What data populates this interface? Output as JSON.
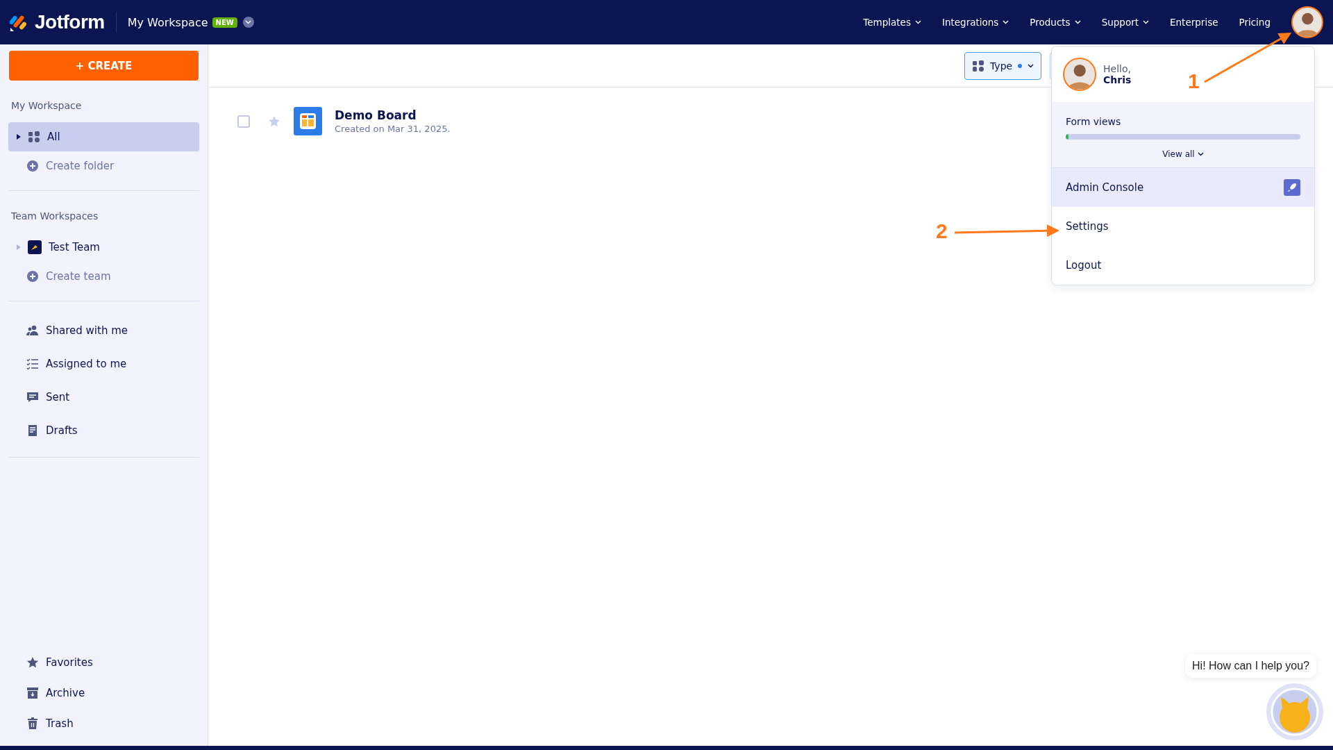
{
  "header": {
    "logo": "Jotform",
    "workspace": "My Workspace",
    "badge": "NEW",
    "nav": [
      {
        "label": "Templates",
        "has_menu": true
      },
      {
        "label": "Integrations",
        "has_menu": true
      },
      {
        "label": "Products",
        "has_menu": true
      },
      {
        "label": "Support",
        "has_menu": true
      },
      {
        "label": "Enterprise",
        "has_menu": false
      },
      {
        "label": "Pricing",
        "has_menu": false
      }
    ]
  },
  "sidebar": {
    "create_button": "+ CREATE",
    "sections": [
      {
        "heading": "My Workspace",
        "items": [
          {
            "kind": "tree",
            "label": "All",
            "selected": true
          },
          {
            "kind": "action",
            "label": "Create folder",
            "selected": false
          }
        ]
      },
      {
        "heading": "Team Workspaces",
        "items": [
          {
            "kind": "team",
            "label": "Test Team",
            "selected": false
          },
          {
            "kind": "action",
            "label": "Create team",
            "selected": false
          }
        ]
      },
      {
        "items": [
          {
            "kind": "link",
            "label": "Shared with me",
            "selected": false
          },
          {
            "kind": "link",
            "label": "Assigned to me",
            "selected": false
          },
          {
            "kind": "link",
            "label": "Sent",
            "selected": false
          },
          {
            "kind": "link",
            "label": "Drafts",
            "selected": false
          }
        ]
      }
    ],
    "bottom_items": [
      {
        "label": "Favorites",
        "selected": false
      },
      {
        "label": "Archive",
        "selected": false
      },
      {
        "label": "Trash",
        "selected": false
      }
    ]
  },
  "toolbar": {
    "filter_button": "Type",
    "filter_active": true
  },
  "items": [
    {
      "title": "Demo Board",
      "subtitle": "Created on Mar 31, 2025.",
      "checked": false,
      "starred": false
    }
  ],
  "user_menu": {
    "greeting": "Hello,",
    "name": "Chris",
    "usage_label": "Form views",
    "level": 0.01,
    "view_all": "View all",
    "entries": [
      {
        "label": "Admin Console",
        "selected": true,
        "kind": "admin"
      },
      {
        "label": "Settings",
        "selected": false,
        "kind": "plain"
      },
      {
        "label": "Logout",
        "selected": false,
        "kind": "plain"
      }
    ]
  },
  "annotations": [
    {
      "number": "1"
    },
    {
      "number": "2"
    }
  ],
  "chat": {
    "message": "Hi! How can I help you?"
  }
}
